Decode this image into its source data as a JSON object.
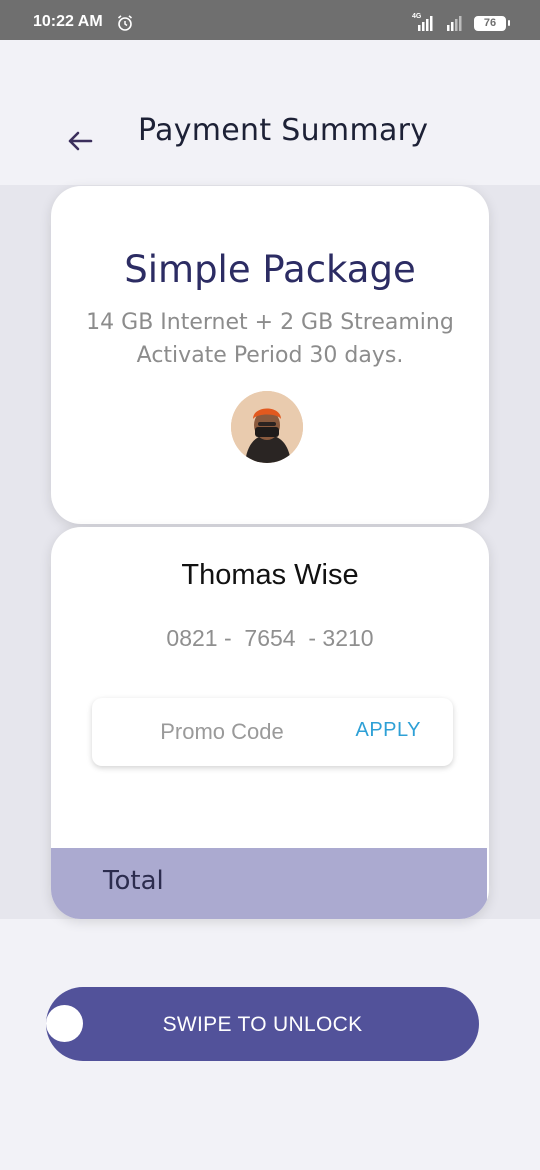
{
  "status_bar": {
    "time": "10:22 AM",
    "network_type": "4G",
    "battery_level": "76",
    "icons": [
      "alarm-icon",
      "signal-icon",
      "battery-icon"
    ]
  },
  "header": {
    "back_icon": "arrow-left-icon",
    "title": "Payment Summary"
  },
  "package": {
    "title": "Simple Package",
    "description_line1": "14 GB Internet + 2 GB Streaming",
    "description_line2": "Activate Period 30 days."
  },
  "user": {
    "name": "Thomas Wise",
    "phone": "0821 -  7654  - 3210"
  },
  "promo": {
    "placeholder": "Promo Code",
    "apply_label": "APPLY"
  },
  "total": {
    "label": "Total"
  },
  "swipe": {
    "label": "SWIPE TO UNLOCK"
  },
  "colors": {
    "accent": "#52529a",
    "total_bar": "#abaad0",
    "apply": "#2ea0d6",
    "title": "#2c2c63"
  }
}
